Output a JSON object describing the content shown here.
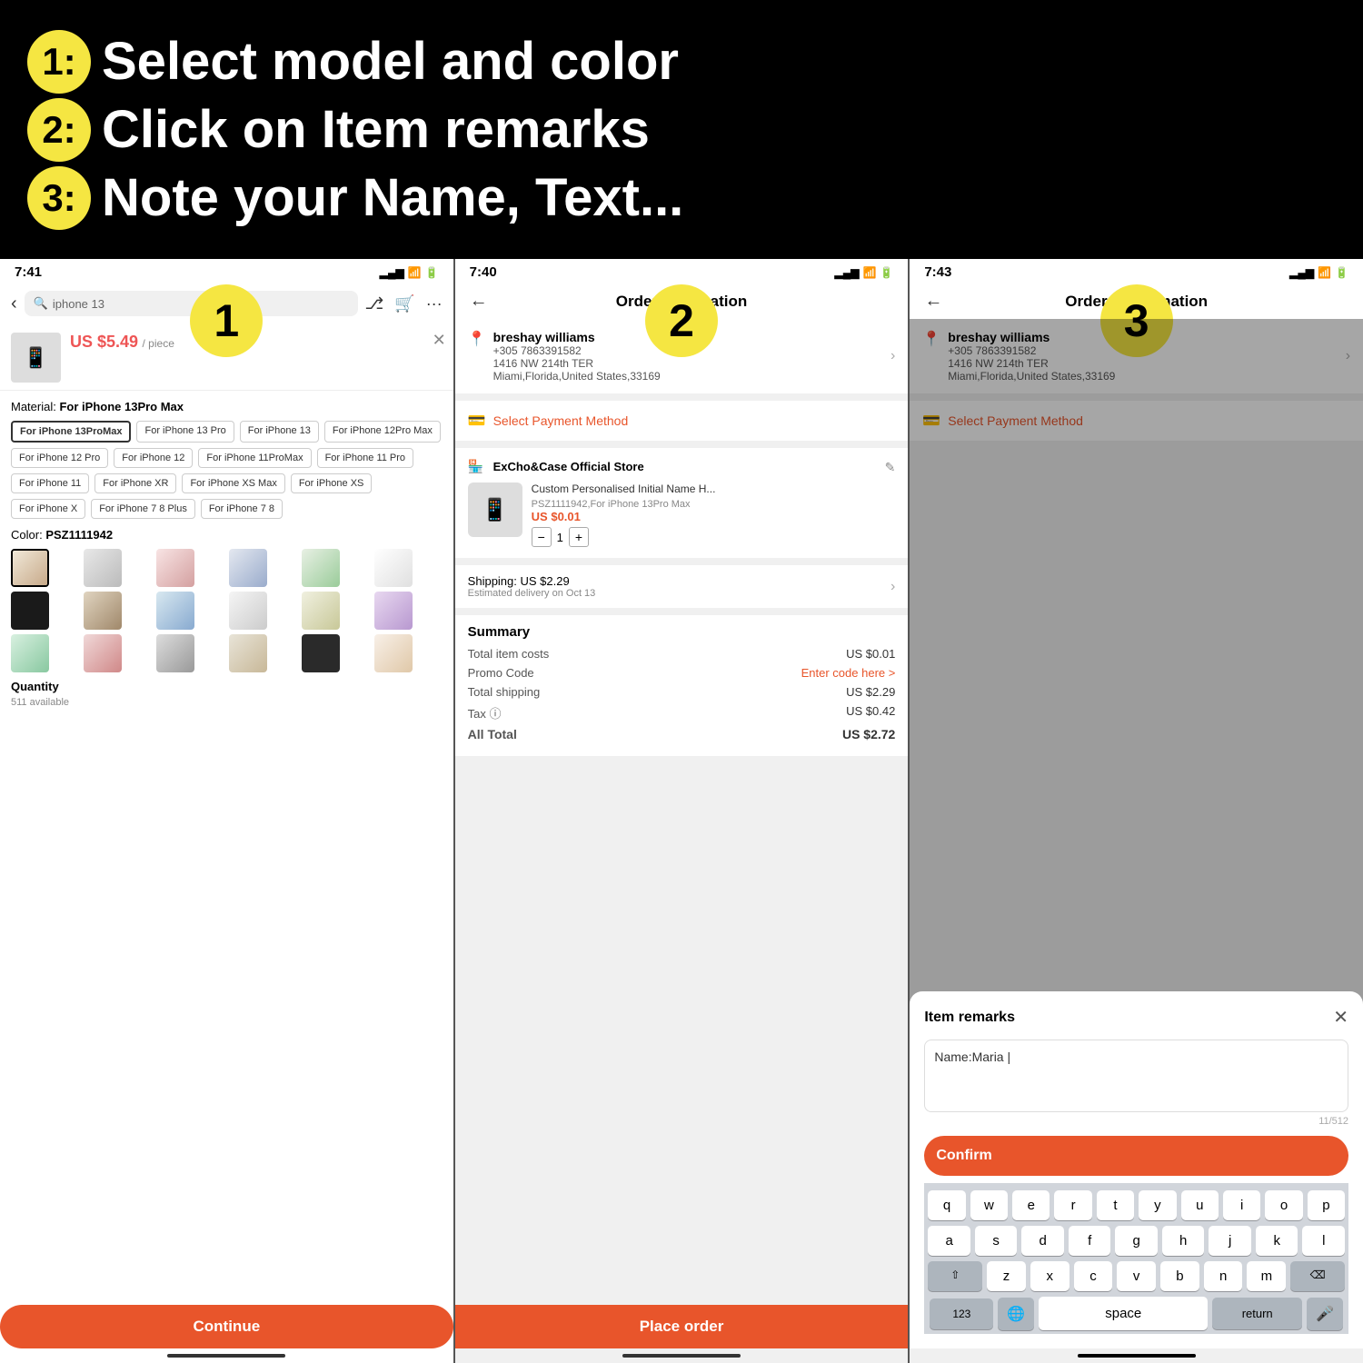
{
  "instructions": {
    "step1": {
      "number": "1:",
      "text": "Select model and color"
    },
    "step2": {
      "number": "2:",
      "text": "Click on Item remarks"
    },
    "step3": {
      "number": "3:",
      "text": "Note your Name, Text..."
    }
  },
  "phone1": {
    "status_time": "7:41",
    "step_badge": "1",
    "search_placeholder": "iphone 13",
    "price": "US $5.49",
    "price_unit": "/ piece",
    "material_label": "Material:",
    "material_value": "For iPhone 13Pro Max",
    "models": [
      "For iPhone 13ProMax",
      "For iPhone 13 Pro",
      "For iPhone 13",
      "For iPhone 12Pro Max",
      "For iPhone 12 Pro",
      "For iPhone 12",
      "For iPhone 11ProMax",
      "For iPhone 11 Pro",
      "For iPhone 11",
      "For iPhone XR",
      "For iPhone XS Max",
      "For iPhone XS",
      "For iPhone X",
      "For iPhone 7 8 Plus",
      "For iPhone 7 8"
    ],
    "selected_model": "For iPhone 13ProMax",
    "color_label": "Color:",
    "color_value": "PSZ1111942",
    "quantity_label": "Quantity",
    "available": "511 available",
    "continue_btn": "Continue"
  },
  "phone2": {
    "status_time": "7:40",
    "step_badge": "2",
    "nav_title": "Order Information",
    "address_name": "breshay williams",
    "address_phone": "+305 7863391582",
    "address_street": "1416 NW 214th TER",
    "address_city": "Miami,Florida,United States,33169",
    "payment_text": "Select Payment Method",
    "store_name": "ExCho&Case Official Store",
    "item_title": "Custom Personalised Initial Name H...",
    "item_sub": "PSZ1111942,For iPhone 13Pro Max",
    "item_price": "US $0.01",
    "item_qty": "1",
    "shipping_label": "Shipping: US $2.29",
    "shipping_sub": "Estimated delivery on Oct 13",
    "summary_title": "Summary",
    "total_item": "Total item costs",
    "total_item_val": "US $0.01",
    "promo": "Promo Code",
    "promo_val": "Enter code here >",
    "shipping": "Total shipping",
    "shipping_val": "US $2.29",
    "tax": "Tax",
    "tax_val": "US $0.42",
    "all_total": "All Total",
    "all_total_val": "US $2.72",
    "place_order_btn": "Place order"
  },
  "phone3": {
    "status_time": "7:43",
    "step_badge": "3",
    "nav_title": "Order Confirmation",
    "address_name": "breshay williams",
    "address_phone": "+305 7863391582",
    "address_street": "1416 NW 214th TER",
    "address_city": "Miami,Florida,United States,33169",
    "payment_text": "Select Payment Method",
    "modal_title": "Item remarks",
    "remarks_text": "Name:Maria |",
    "char_count": "11/512",
    "confirm_btn": "Confirm",
    "keyboard": {
      "row1": [
        "q",
        "w",
        "e",
        "r",
        "t",
        "y",
        "u",
        "i",
        "o",
        "p"
      ],
      "row2": [
        "a",
        "s",
        "d",
        "f",
        "g",
        "h",
        "j",
        "k",
        "l"
      ],
      "row3": [
        "z",
        "x",
        "c",
        "v",
        "b",
        "n",
        "m"
      ],
      "space": "space",
      "return": "return",
      "num": "123"
    }
  }
}
